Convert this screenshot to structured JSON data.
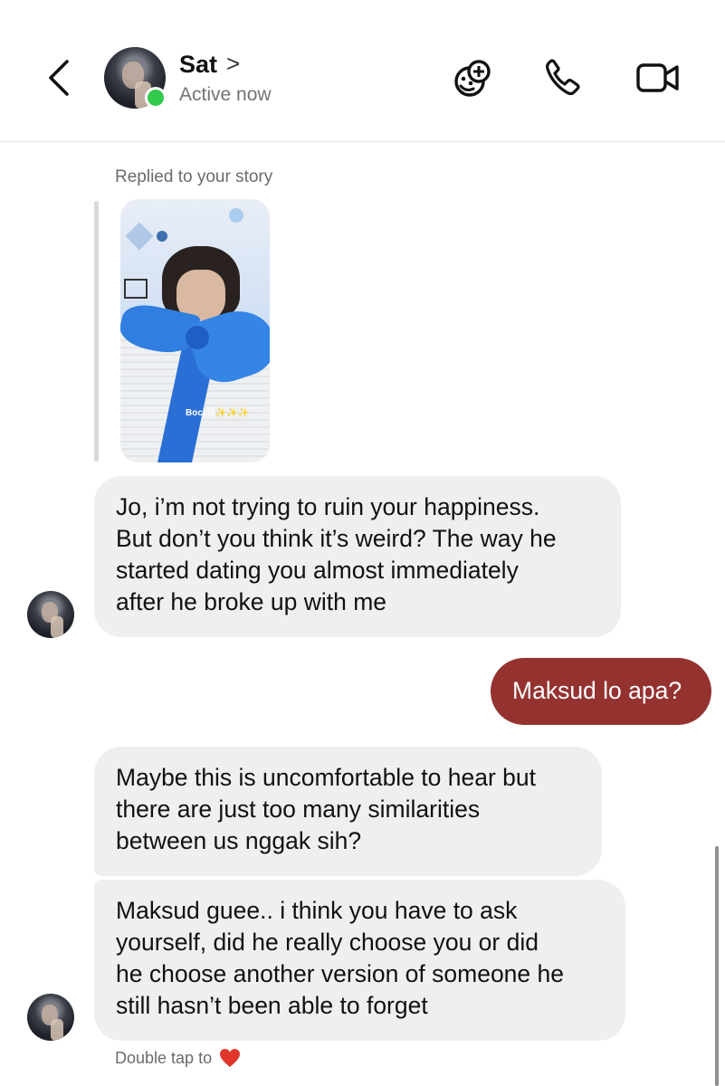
{
  "header": {
    "contact_name": "Sat",
    "name_chevron": ">",
    "status": "Active now",
    "icons": [
      "back-icon",
      "game-icon",
      "phone-icon",
      "video-icon"
    ]
  },
  "story_reply": {
    "label": "Replied to your story",
    "story_caption": "Bociiiii",
    "story_caption_emoji": "✨✨✨"
  },
  "messages": [
    {
      "from": "them",
      "lines": [
        "Jo, i’m not trying to ruin your happiness.",
        "But don’t you think it’s weird? The way he",
        "started dating you almost immediately",
        "after he broke up with me"
      ]
    },
    {
      "from": "me",
      "lines": [
        "Maksud lo apa?"
      ]
    },
    {
      "from": "them",
      "lines": [
        "Maybe this is uncomfortable to hear but",
        "there are just too many similarities",
        "between us nggak sih?"
      ]
    },
    {
      "from": "them",
      "lines": [
        "Maksud guee.. i think you have to ask",
        "yourself, did he really choose you or did",
        "he choose another version of someone he",
        "still hasn’t been able to forget"
      ]
    }
  ],
  "footer_hint": "Double tap to",
  "colors": {
    "outgoing_bubble": "#943230",
    "incoming_bubble": "#efefef",
    "online_dot": "#31c94b",
    "heart": "#e0362c"
  }
}
